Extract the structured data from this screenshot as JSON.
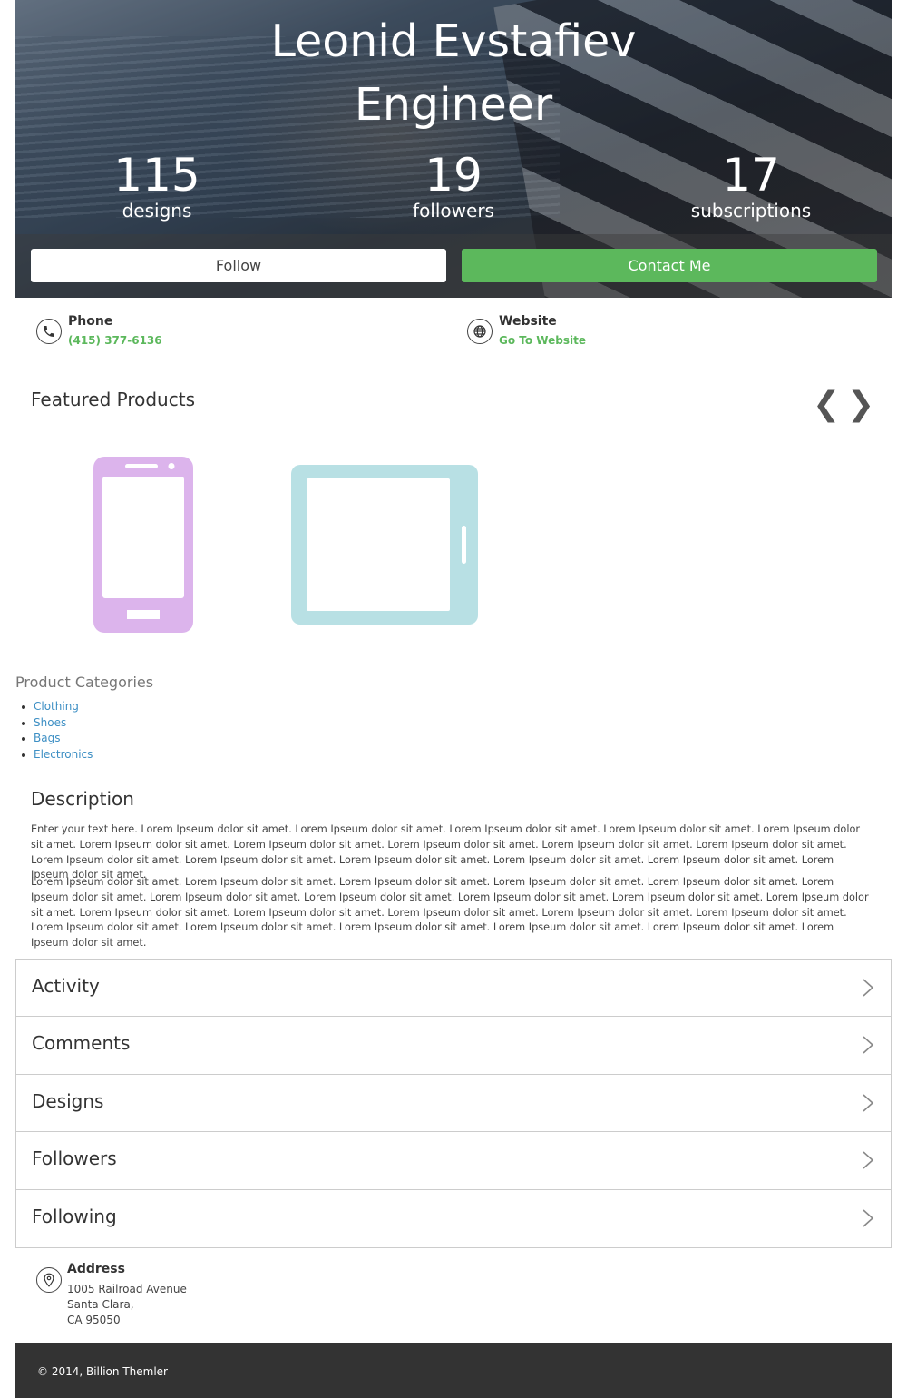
{
  "profile": {
    "name": "Leonid Evstafiev",
    "role": "Engineer",
    "stats": [
      {
        "value": "115",
        "label": "designs"
      },
      {
        "value": "19",
        "label": "followers"
      },
      {
        "value": "17",
        "label": "subscriptions"
      }
    ],
    "follow_label": "Follow",
    "contact_label": "Contact Me"
  },
  "contact": {
    "phone_title": "Phone",
    "phone_value": "(415) 377-6136",
    "website_title": "Website",
    "website_value": "Go To Website"
  },
  "featured": {
    "title": "Featured Products",
    "prev": "❮",
    "next": "❯",
    "products": [
      {
        "icon": "smartphone-icon",
        "color": "#dcb4ec"
      },
      {
        "icon": "tablet-icon",
        "color": "#b8e0e4"
      }
    ]
  },
  "categories": {
    "title": "Product Categories",
    "items": [
      "Clothing",
      "Shoes",
      "Bags",
      "Electronics"
    ]
  },
  "description": {
    "title": "Description",
    "p1": "Enter your text here. Lorem Ipseum dolor sit amet. Lorem Ipseum dolor sit amet. Lorem Ipseum dolor sit amet. Lorem Ipseum dolor sit amet. Lorem Ipseum dolor sit amet. Lorem Ipseum dolor sit amet. Lorem Ipseum dolor sit amet. Lorem Ipseum dolor sit amet. Lorem Ipseum dolor sit amet. Lorem Ipseum dolor sit amet. Lorem Ipseum dolor sit amet. Lorem Ipseum dolor sit amet. Lorem Ipseum dolor sit amet. Lorem Ipseum dolor sit amet. Lorem Ipseum dolor sit amet. Lorem Ipseum dolor sit amet.",
    "p2": "Lorem Ipseum dolor sit amet. Lorem Ipseum dolor sit amet. Lorem Ipseum dolor sit amet. Lorem Ipseum dolor sit amet. Lorem Ipseum dolor sit amet. Lorem Ipseum dolor sit amet. Lorem Ipseum dolor sit amet. Lorem Ipseum dolor sit amet. Lorem Ipseum dolor sit amet. Lorem Ipseum dolor sit amet. Lorem Ipseum dolor sit amet. Lorem Ipseum dolor sit amet. Lorem Ipseum dolor sit amet. Lorem Ipseum dolor sit amet. Lorem Ipseum dolor sit amet. Lorem Ipseum dolor sit amet. Lorem Ipseum dolor sit amet. Lorem Ipseum dolor sit amet. Lorem Ipseum dolor sit amet. Lorem Ipseum dolor sit amet. Lorem Ipseum dolor sit amet. Lorem Ipseum dolor sit amet."
  },
  "sections": [
    "Activity",
    "Comments",
    "Designs",
    "Followers",
    "Following"
  ],
  "address": {
    "title": "Address",
    "line1": "1005 Railroad Avenue",
    "line2": "Santa Clara,",
    "line3": "CA 95050"
  },
  "footer": {
    "text": "© 2014, Billion Themler"
  },
  "colors": {
    "accent": "#5cb85c",
    "link": "#3d8fc4",
    "footer_bg": "#333333"
  }
}
